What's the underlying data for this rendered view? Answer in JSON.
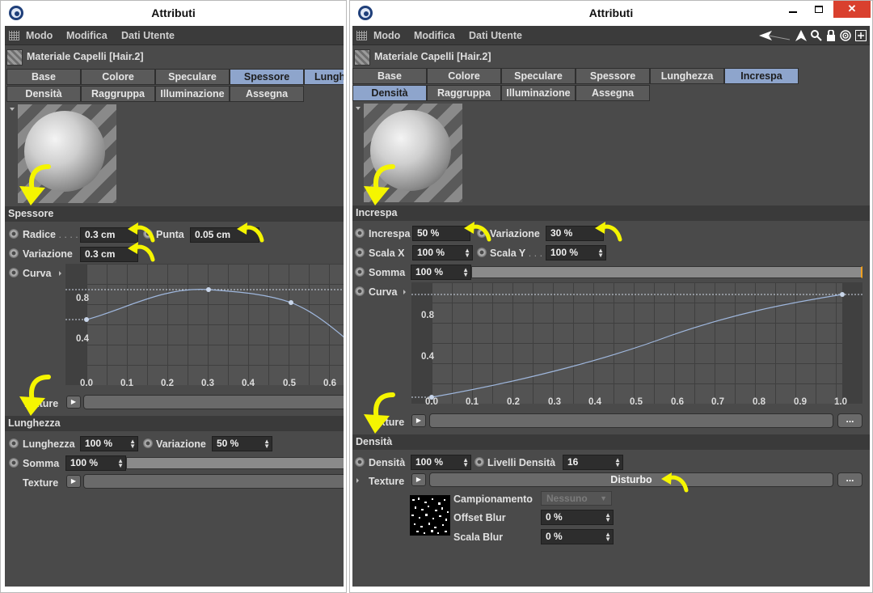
{
  "left": {
    "title": "Attributi",
    "menu": [
      "Modo",
      "Modifica",
      "Dati Utente"
    ],
    "material_title": "Materiale Capelli [Hair.2]",
    "tabs_row1": [
      "Base",
      "Colore",
      "Speculare",
      "Spessore",
      "Lunghezza"
    ],
    "tabs_row2": [
      "Densità",
      "Raggruppa",
      "Illuminazione",
      "Assegna"
    ],
    "section_spessore": "Spessore",
    "radice_label": "Radice",
    "radice_dots": " . . . .",
    "radice_value": "0.3 cm",
    "punta_label": "Punta",
    "punta_value": "0.05 cm",
    "variazione_label": "Variazione",
    "variazione_value": "0.3 cm",
    "curva_label": "Curva",
    "y_ticks": [
      "0.8",
      "0.4"
    ],
    "x_ticks": [
      "0.0",
      "0.1",
      "0.2",
      "0.3",
      "0.4",
      "0.5",
      "0.6"
    ],
    "texture_label": "Texture",
    "section_lunghezza": "Lunghezza",
    "lunghezza_label": "Lunghezza",
    "lunghezza_value": "100 %",
    "lvar_label": "Variazione",
    "lvar_value": "50 %",
    "somma_label": "Somma",
    "somma_value": "100 %",
    "texture2_label": "Texture"
  },
  "right": {
    "title": "Attributi",
    "menu": [
      "Modo",
      "Modifica",
      "Dati Utente"
    ],
    "material_title": "Materiale Capelli [Hair.2]",
    "tabs_row1": [
      "Base",
      "Colore",
      "Speculare",
      "Spessore",
      "Lunghezza",
      "Increspa"
    ],
    "tabs_row2": [
      "Densità",
      "Raggruppa",
      "Illuminazione",
      "Assegna"
    ],
    "section_increspa": "Increspa",
    "increspa_label": "Increspa",
    "increspa_value": "50 %",
    "variazione_label": "Variazione",
    "variazione_value": "30 %",
    "scalax_label": "Scala X",
    "scalax_value": "100 %",
    "scalay_label": "Scala Y",
    "scalay_dots": " . . . .",
    "scalay_value": "100 %",
    "somma_label": "Somma",
    "somma_value": "100 %",
    "curva_label": "Curva",
    "y_ticks": [
      "0.8",
      "0.4"
    ],
    "x_ticks": [
      "0.0",
      "0.1",
      "0.2",
      "0.3",
      "0.4",
      "0.5",
      "0.6",
      "0.7",
      "0.8",
      "0.9",
      "1.0"
    ],
    "texture_label": "Texture",
    "more_label": "...",
    "section_densita": "Densità",
    "densita_label": "Densità",
    "densita_value": "100 %",
    "livelli_label": "Livelli Densità",
    "livelli_value": "16",
    "texture2_label": "Texture",
    "disturbo_label": "Disturbo",
    "more2_label": "...",
    "campionamento_label": "Campionamento",
    "campionamento_value": "Nessuno",
    "offset_label": "Offset Blur",
    "offset_value": "0 %",
    "scala_blur_label": "Scala Blur",
    "scala_blur_value": "0 %"
  },
  "colors": {
    "active_tab": "#8ea5cc",
    "panel": "#4a4a4a",
    "annotation": "#f5f500",
    "close": "#d9402e"
  },
  "icons": [
    "cinema4d-app-icon",
    "back-arrow-icon",
    "cursor-arrow-icon",
    "search-icon",
    "lock-icon",
    "target-icon",
    "add-icon"
  ]
}
